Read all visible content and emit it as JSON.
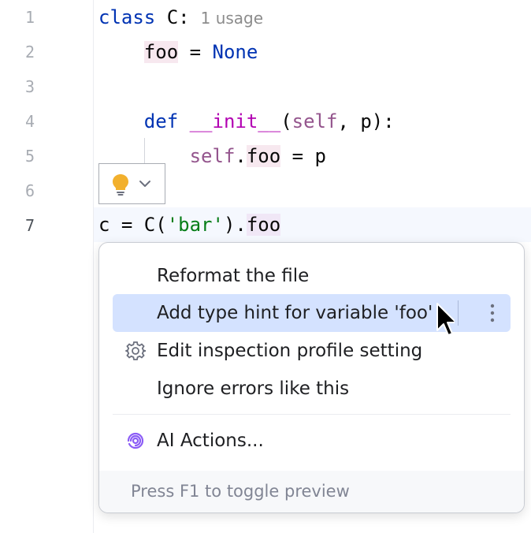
{
  "editor": {
    "line_numbers": [
      "1",
      "2",
      "3",
      "4",
      "5",
      "6",
      "7"
    ],
    "line1": {
      "kw": "class",
      "name": " C:",
      "usage": "1 usage"
    },
    "line2": {
      "var": "foo",
      "op": " = ",
      "val": "None"
    },
    "line4": {
      "kw": "def",
      "fn": "__init__",
      "open": "(",
      "self": "self",
      "params": ", p):"
    },
    "line5": {
      "self": "self",
      "dot": ".",
      "attr": "foo",
      "rest": " = p"
    },
    "line7": {
      "pre": "c = C(",
      "str": "'bar'",
      "mid": ").",
      "attr": "foo"
    }
  },
  "intention_bulb": {
    "icon": "lightbulb-icon",
    "dropdown_icon": "chevron-down-icon"
  },
  "popup": {
    "items": [
      {
        "label": "Reformat the file",
        "icon": null
      },
      {
        "label": "Add type hint for variable 'foo'",
        "icon": null,
        "more_icon": "more-vertical-icon"
      },
      {
        "label": "Edit inspection profile setting",
        "icon": "gear-icon"
      },
      {
        "label": "Ignore errors like this",
        "icon": null
      },
      {
        "label": "AI Actions...",
        "icon": "ai-spiral-icon"
      }
    ],
    "footer": "Press F1 to toggle preview"
  },
  "colors": {
    "keyword": "#0033b3",
    "magic": "#b200b2",
    "self": "#94558d",
    "string": "#067d17",
    "selection": "#d4e2ff",
    "bulb": "#f2b02d",
    "ai": "#8b5cf6"
  }
}
